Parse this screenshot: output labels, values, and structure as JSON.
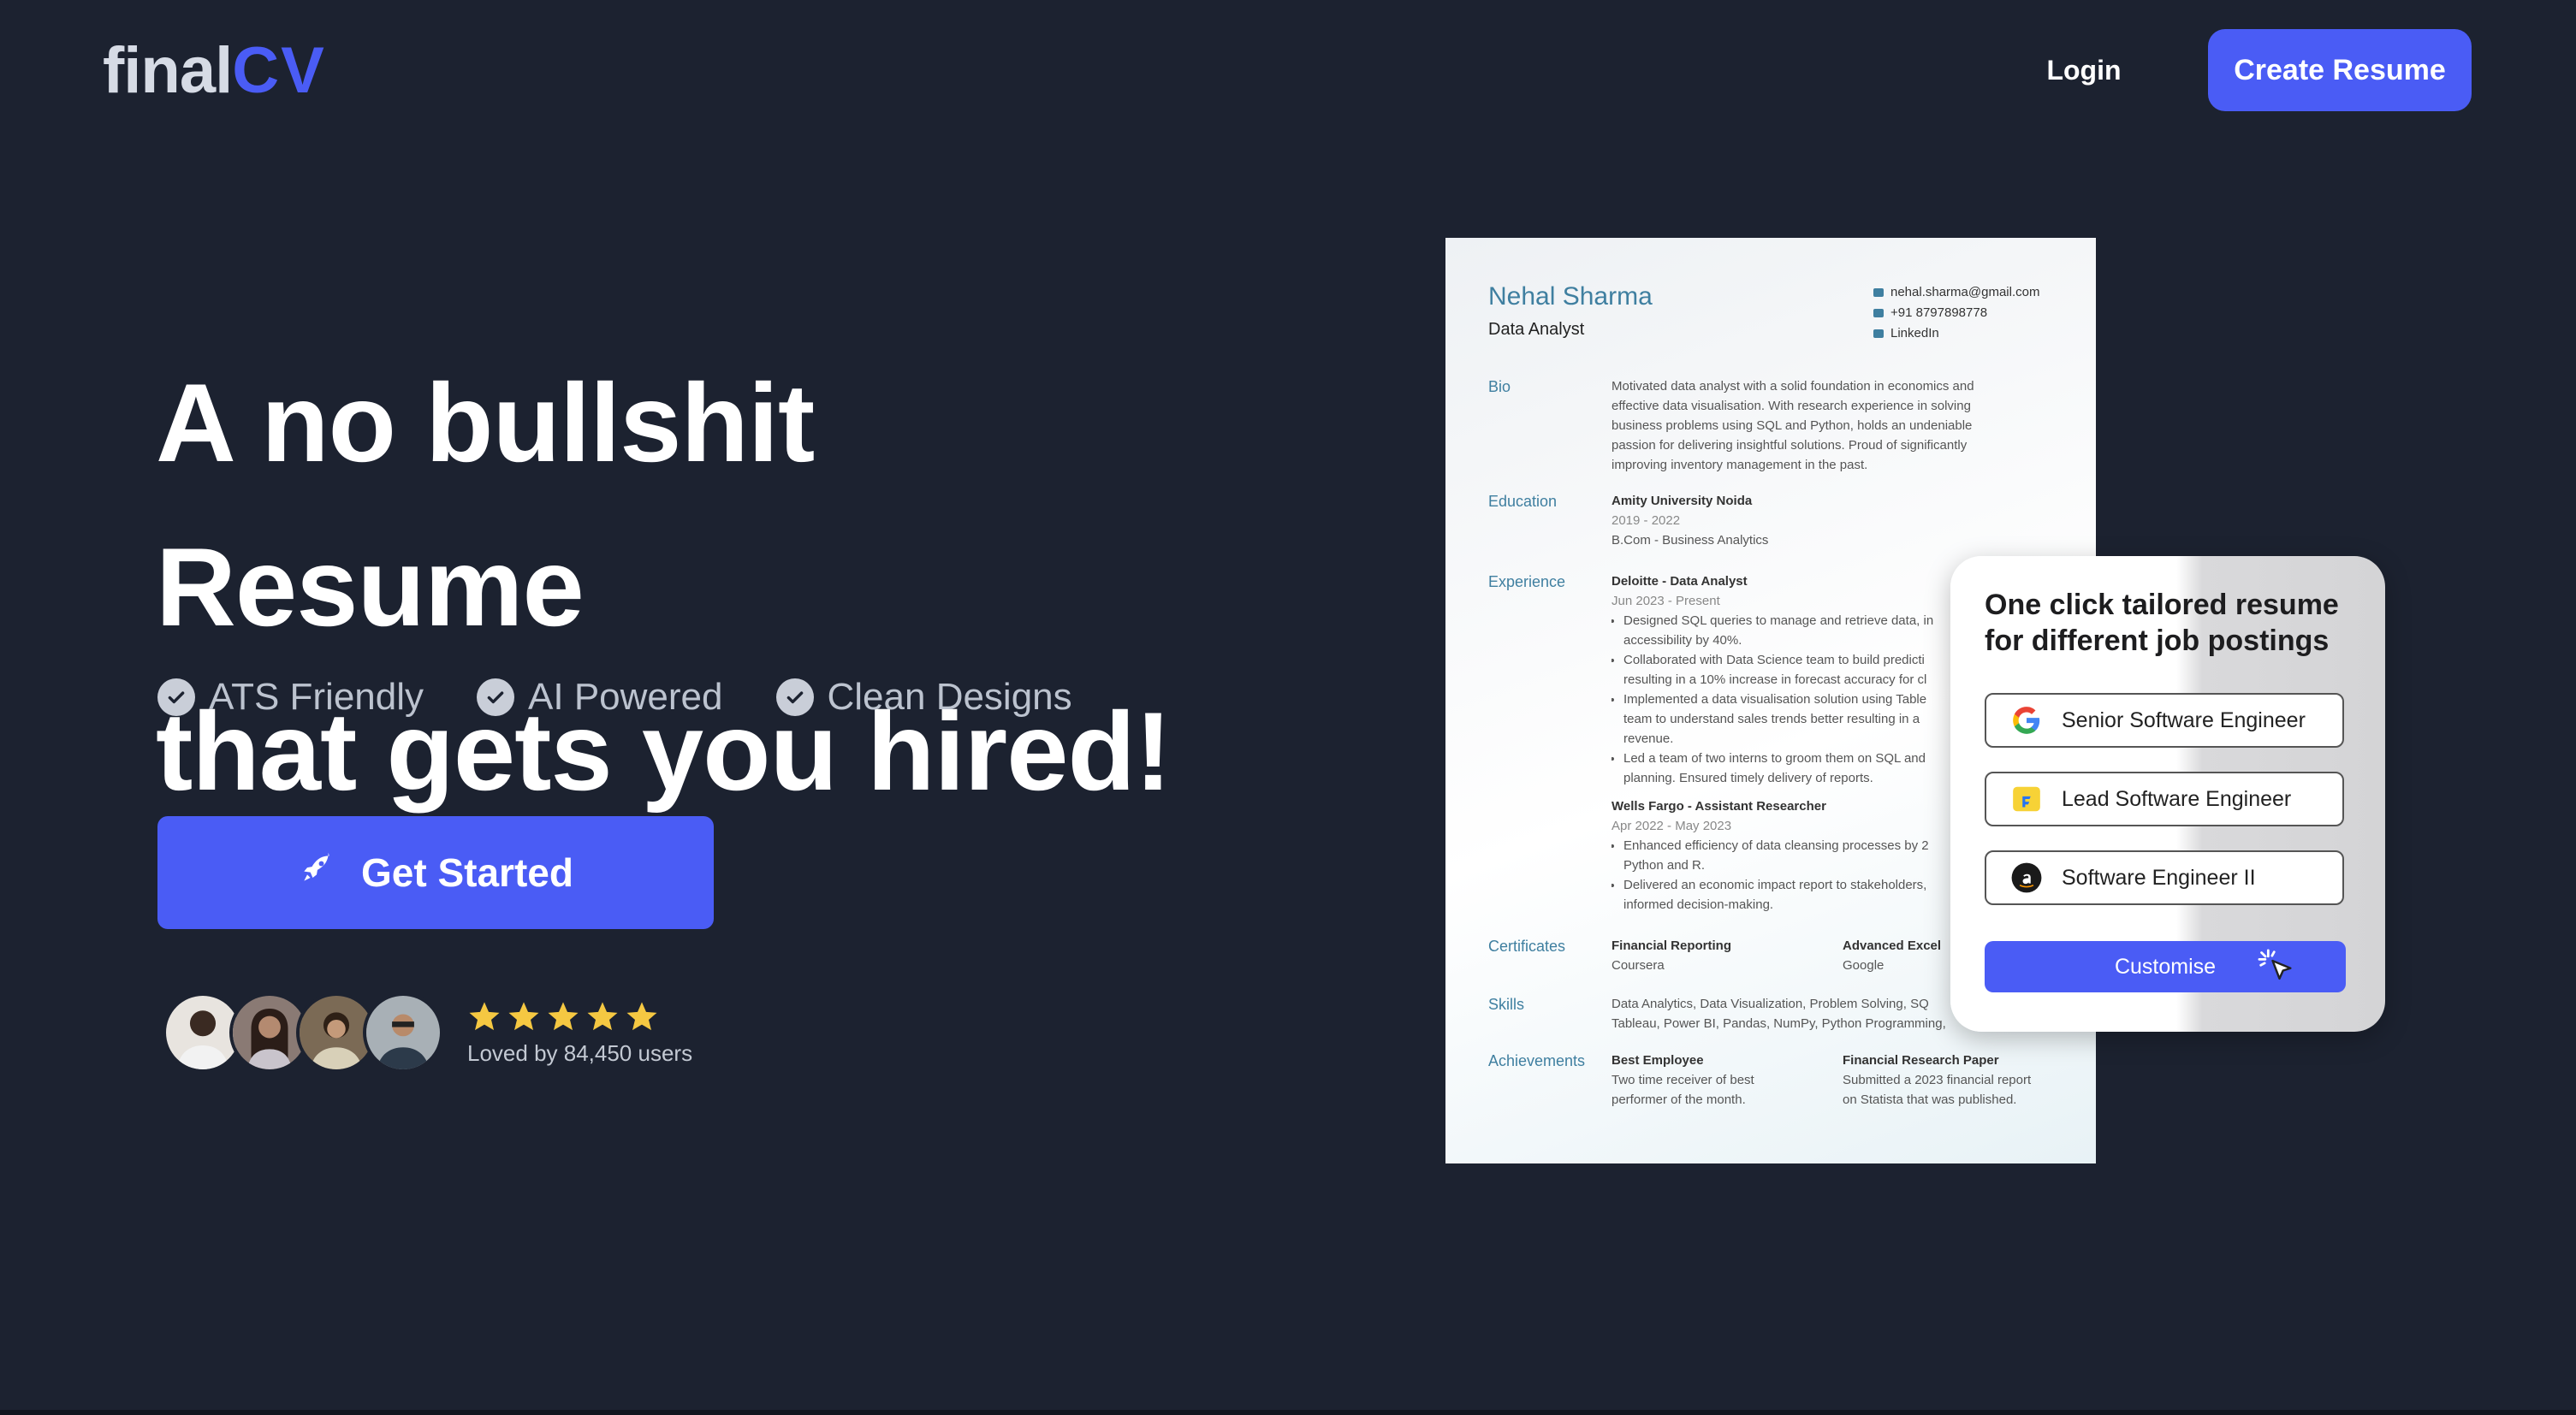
{
  "nav": {
    "logo_part1": "final",
    "logo_part2": "CV",
    "login_label": "Login",
    "create_label": "Create Resume"
  },
  "hero": {
    "headline_line1": "A no bullshit Resume",
    "headline_line2": "that gets you hired!",
    "features": [
      "ATS Friendly",
      "AI Powered",
      "Clean Designs"
    ],
    "cta_label": "Get Started",
    "rating_stars": 5,
    "loved_text": "Loved by 84,450 users"
  },
  "resume": {
    "name": "Nehal Sharma",
    "role": "Data Analyst",
    "email": "nehal.sharma@gmail.com",
    "phone": "+91 8797898778",
    "linkedin": "LinkedIn",
    "labels": {
      "bio": "Bio",
      "education": "Education",
      "experience": "Experience",
      "certificates": "Certificates",
      "skills": "Skills",
      "achievements": "Achievements"
    },
    "bio_lines": [
      "Motivated data analyst with a solid foundation in economics and",
      "effective data visualisation. With research experience in solving",
      "business problems using SQL and Python, holds an undeniable",
      "passion for delivering insightful solutions. Proud of significantly",
      "improving inventory management in the past."
    ],
    "education": {
      "school": "Amity University Noida",
      "years": "2019 - 2022",
      "degree": "B.Com - Business Analytics"
    },
    "exp1": {
      "title": "Deloitte - Data Analyst",
      "dates": "Jun 2023 - Present",
      "b1a": "Designed SQL queries to manage and retrieve data, in",
      "b1b": "accessibility by 40%.",
      "b2a": "Collaborated with Data Science team to build predicti",
      "b2b": "resulting in a 10% increase in forecast accuracy for cl",
      "b3a": "Implemented a data visualisation solution using Table",
      "b3b": "team to understand sales trends better resulting in a",
      "b3c": "revenue.",
      "b4a": "Led a team of two interns to groom them on SQL and",
      "b4b": "planning. Ensured timely delivery of reports."
    },
    "exp2": {
      "title": "Wells Fargo - Assistant Researcher",
      "dates": "Apr 2022 - May 2023",
      "b1a": "Enhanced efficiency of data cleansing processes by 2",
      "b1b": "Python and R.",
      "b2a": "Delivered an economic impact report to stakeholders,",
      "b2b": "informed decision-making."
    },
    "certificates": {
      "c1_name": "Financial Reporting",
      "c1_org": "Coursera",
      "c2_name": "Advanced Excel",
      "c2_org": "Google"
    },
    "skills_line1": "Data Analytics, Data Visualization, Problem Solving, SQ",
    "skills_line2": "Tableau, Power BI, Pandas, NumPy, Python Programming,",
    "achievements": {
      "a1_title": "Best Employee",
      "a1_l1": "Two time receiver of best",
      "a1_l2": "performer of the month.",
      "a2_title": "Financial Research Paper",
      "a2_l1": "Submitted a 2023 financial report",
      "a2_l2": "on Statista that was published."
    }
  },
  "popup": {
    "title_line1": "One click tailored resume",
    "title_line2": "for different job postings",
    "jobs": [
      {
        "label": "Senior Software Engineer",
        "icon": "google-icon"
      },
      {
        "label": "Lead Software Engineer",
        "icon": "flipkart-icon"
      },
      {
        "label": "Software Engineer II",
        "icon": "amazon-icon"
      }
    ],
    "customise_label": "Customise"
  },
  "colors": {
    "background": "#1c2230",
    "accent": "#4a5cf5",
    "star": "#f5c842",
    "resume_heading": "#3f7fa0"
  }
}
